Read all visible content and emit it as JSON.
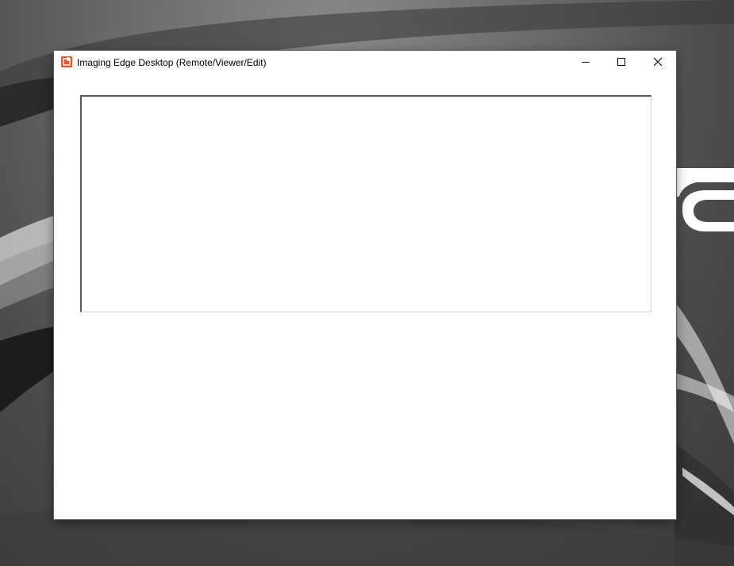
{
  "window": {
    "title": "Imaging Edge Desktop (Remote/Viewer/Edit)",
    "app_icon": "imaging-edge-icon",
    "accent_color": "#e8542e",
    "controls": [
      "minimize-icon",
      "maximize-icon",
      "close-icon"
    ]
  },
  "content": {
    "panel": "empty-content-panel"
  }
}
